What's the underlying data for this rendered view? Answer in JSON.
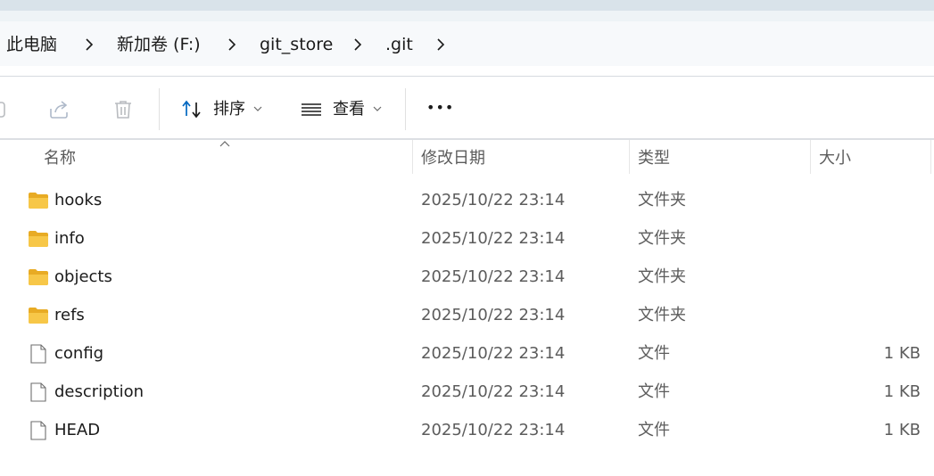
{
  "breadcrumb": {
    "items": [
      "此电脑",
      "新加卷 (F:)",
      "git_store",
      ".git"
    ]
  },
  "toolbar": {
    "icons": [
      "share-icon",
      "delete-icon"
    ],
    "sort_label": "排序",
    "view_label": "查看",
    "more_label": "•••"
  },
  "columns": {
    "name": "名称",
    "date": "修改日期",
    "type": "类型",
    "size": "大小"
  },
  "files": [
    {
      "name": "hooks",
      "date": "2025/10/22 23:14",
      "type": "文件夹",
      "size": "",
      "icon": "folder-icon"
    },
    {
      "name": "info",
      "date": "2025/10/22 23:14",
      "type": "文件夹",
      "size": "",
      "icon": "folder-icon"
    },
    {
      "name": "objects",
      "date": "2025/10/22 23:14",
      "type": "文件夹",
      "size": "",
      "icon": "folder-icon"
    },
    {
      "name": "refs",
      "date": "2025/10/22 23:14",
      "type": "文件夹",
      "size": "",
      "icon": "folder-icon"
    },
    {
      "name": "config",
      "date": "2025/10/22 23:14",
      "type": "文件",
      "size": "1 KB",
      "icon": "file-icon"
    },
    {
      "name": "description",
      "date": "2025/10/22 23:14",
      "type": "文件",
      "size": "1 KB",
      "icon": "file-icon"
    },
    {
      "name": "HEAD",
      "date": "2025/10/22 23:14",
      "type": "文件",
      "size": "1 KB",
      "icon": "file-icon"
    }
  ],
  "colors": {
    "folder": "#f7c748",
    "folder_dark": "#e8ab24",
    "text": "#1b1b1b",
    "muted_text": "#5c5c5c",
    "accent": "#0067c0"
  }
}
